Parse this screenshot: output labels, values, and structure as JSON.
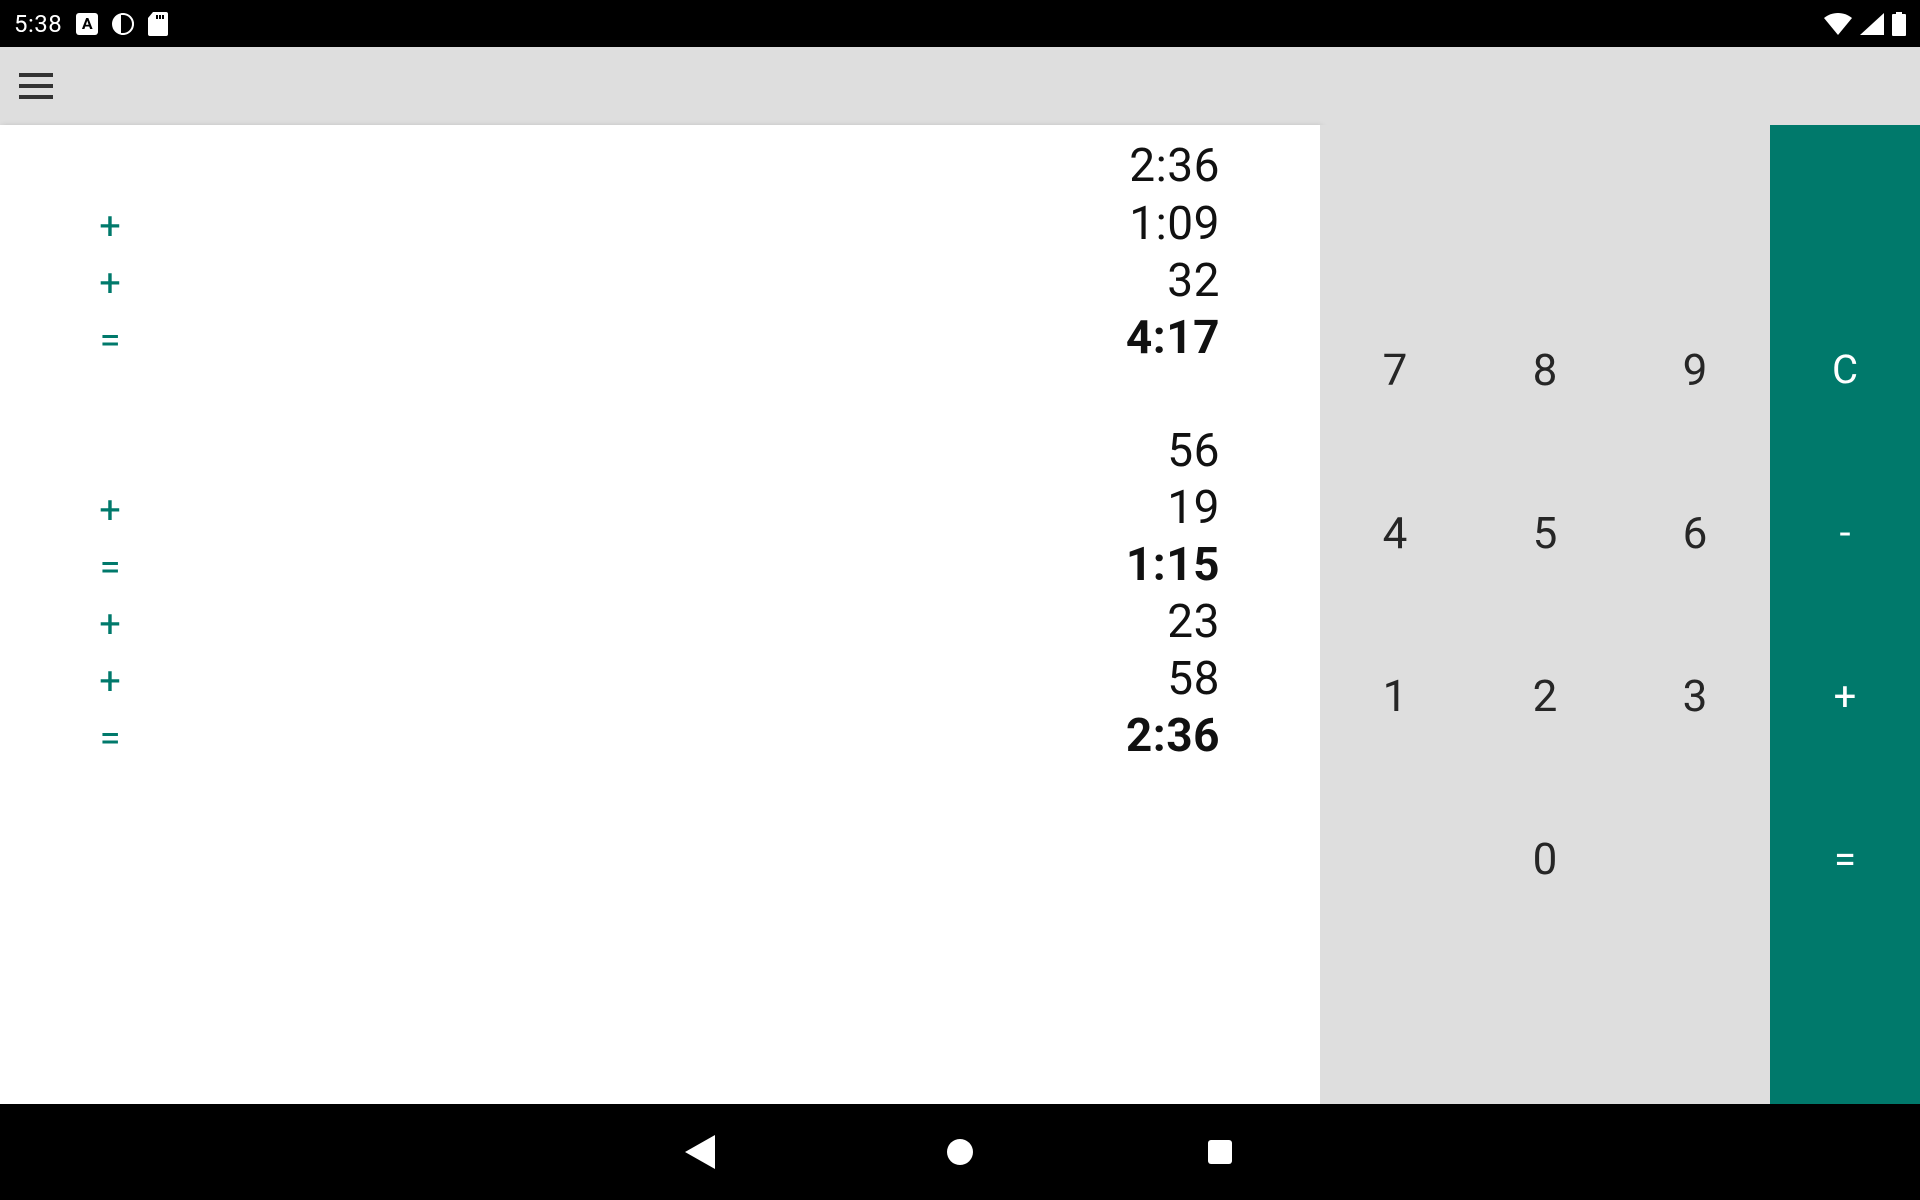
{
  "status": {
    "time": "5:38",
    "badge_a": "A"
  },
  "tape": {
    "rows": [
      {
        "op": "",
        "val": "2:36",
        "bold": false
      },
      {
        "op": "+",
        "val": "1:09",
        "bold": false
      },
      {
        "op": "+",
        "val": "32",
        "bold": false
      },
      {
        "op": "=",
        "val": "4:17",
        "bold": true
      },
      {
        "gap": true
      },
      {
        "op": "",
        "val": "56",
        "bold": false
      },
      {
        "op": "+",
        "val": "19",
        "bold": false
      },
      {
        "op": "=",
        "val": "1:15",
        "bold": true
      },
      {
        "op": "+",
        "val": "23",
        "bold": false
      },
      {
        "op": "+",
        "val": "58",
        "bold": false
      },
      {
        "op": "=",
        "val": "2:36",
        "bold": true
      }
    ]
  },
  "keys": {
    "n7": "7",
    "n8": "8",
    "n9": "9",
    "n4": "4",
    "n5": "5",
    "n6": "6",
    "n1": "1",
    "n2": "2",
    "n3": "3",
    "n0": "0",
    "clear": "C",
    "minus": "-",
    "plus": "+",
    "equals": "="
  },
  "colors": {
    "accent": "#00796b",
    "panel": "#dedede"
  }
}
